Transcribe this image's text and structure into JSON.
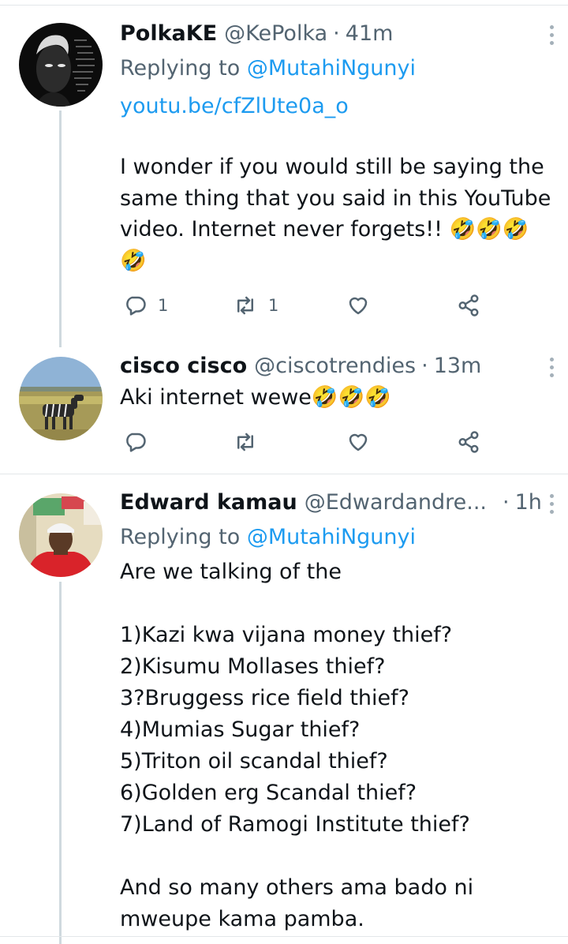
{
  "tweets": [
    {
      "name": "PolkaKE",
      "handle": "@KePolka",
      "time": "41m",
      "replying_prefix": "Replying to ",
      "replying_to": "@MutahiNgunyi",
      "link": "youtu.be/cfZlUte0a_o",
      "text": "I wonder if you would still be saying the same thing that you said in this YouTube video. Internet never forgets!! 🤣🤣🤣 🤣",
      "reply_count": "1",
      "retweet_count": "1",
      "like_count": ""
    },
    {
      "name": "cisco cisco",
      "handle": "@ciscotrendies",
      "time": "13m",
      "text": "Aki internet wewe🤣🤣🤣",
      "reply_count": "",
      "retweet_count": "",
      "like_count": ""
    },
    {
      "name": "Edward kamau",
      "handle": "@Edwardandre...",
      "time": "1h",
      "replying_prefix": "Replying to ",
      "replying_to": "@MutahiNgunyi",
      "text": "Are we talking of the\n\n1)Kazi kwa vijana money thief?\n2)Kisumu Mollases thief?\n3?Bruggess rice field thief?\n4)Mumias Sugar thief?\n5)Triton oil scandal thief?\n6)Golden erg Scandal thief?\n7)Land of Ramogi Institute thief?\n\nAnd so many others ama bado ni mweupe kama pamba."
    }
  ],
  "colors": {
    "link": "#1d9bf0",
    "secondary_text": "#536471",
    "thread_line": "#cfd9de"
  },
  "icons": [
    "more-vertical-icon",
    "reply-icon",
    "retweet-icon",
    "like-icon",
    "share-icon"
  ]
}
